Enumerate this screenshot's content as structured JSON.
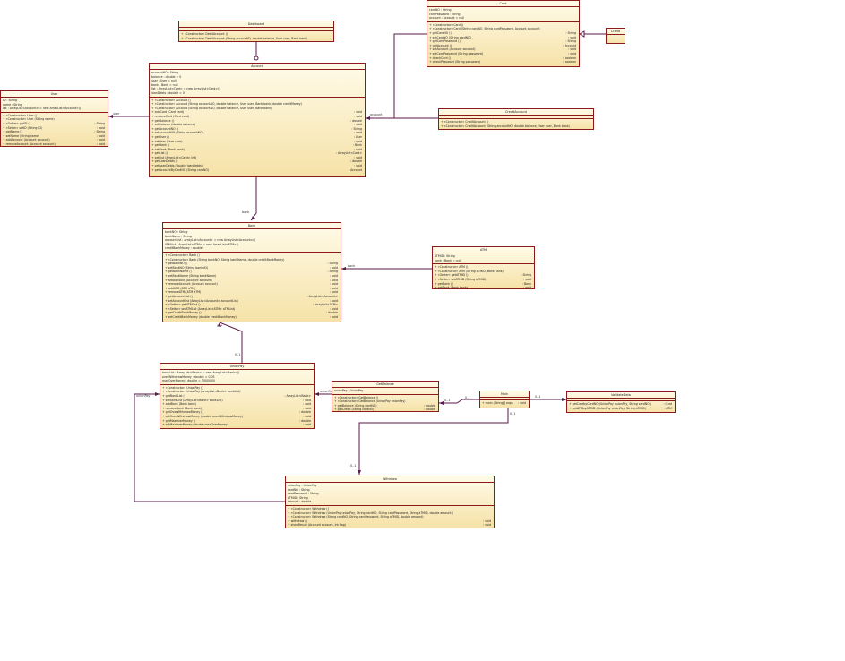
{
  "classes": {
    "dashboard": {
      "title": "Dashboard",
      "attrs": [],
      "methods": [
        "+ «Constructor» DebitAccount ()",
        "+ «Constructor» DebitAccount (String accountID, double balance, User user, Bank bank)"
      ]
    },
    "card": {
      "title": "Card",
      "attrs": [
        "cardNO : String",
        "cardPassword : String",
        "account : Account = null"
      ],
      "methods": [
        "+ «Constructor» Card ()",
        "+ «Constructor» Card (String cardNO, String cardPassword, Account account)",
        "+ getCardNO () : String",
        "+ setCardNO (String cardNO) : void",
        "+ getCardPassword () : String",
        "+ getAccount () : Account",
        "+ setAccount (Account account) : void",
        "+ setCardPassword (String password) : void",
        "+ checkCard () : boolean",
        "+ checkPassword (String password) : boolean"
      ]
    },
    "small": {
      "title": "Credit"
    },
    "user": {
      "title": "User",
      "attrs": [
        "ID : String",
        "name : String",
        "list : ArrayList<Account> = new ArrayList<Account>()"
      ],
      "methods": [
        "+ «Constructor» User ()",
        "+ «Constructor» User (String name)",
        "+ «Getter» getID () : String",
        "+ «Setter» setID (String ID) : void",
        "+ getName () : String",
        "+ setName (String name) : void",
        "+ addAccount (Account account) : void",
        "+ removeAccount (Account account) : void"
      ]
    },
    "account": {
      "title": "Account",
      "attrs": [
        "accountNO : String",
        "balance : double = 0",
        "user : User = null",
        "bank : Bank = null",
        "list : ArrayList<Card> = new ArrayList<Card>()",
        "loanDebts : double = 0"
      ],
      "methods": [
        "+ «Constructor» Account ()",
        "+ «Constructor» Account (String accountNO, double balance, User user, Bank bank, double creditMoney)",
        "+ «Constructor» Account (String accountNO, double balance, User user, Bank bank)",
        "+ addCard (Card card) : void",
        "+ removeCard (Card card) : void",
        "+ getBalance () : double",
        "+ setBalance (double balance) : void",
        "+ getAccountNO () : String",
        "+ setAccountNO (String accountNO) : void",
        "+ getUser () : User",
        "+ setUser (User user) : void",
        "+ getBank () : Bank",
        "+ setBank (Bank bank) : void",
        "+ getList () : ArrayList<Card>",
        "+ setList (ArrayList<Card> list) : void",
        "+ getLoanDebts () : double",
        "+ setLoanDebts (double loanDebts) : void",
        "+ getAccountByCardNO (String cardNO) : Account"
      ]
    },
    "creditAccount": {
      "title": "CreditAccount",
      "attrs": [],
      "methods": [
        "+ «Constructor» CreditAccount ()",
        "+ «Constructor» CreditAccount (String accountNO, double balance, User user, Bank bank)"
      ]
    },
    "bank": {
      "title": "Bank",
      "attrs": [
        "bankNO : String",
        "bankName : String",
        "accountList : ArrayList<Account> = new ArrayList<Account>()",
        "ATMList : ArrayList<ATM> = new ArrayList<ATM>()",
        "creditBankMoney : double"
      ],
      "methods": [
        "+ «Constructor» Bank ()",
        "+ «Constructor» Bank (String bankNO, String bankName, double creditBankMoney)",
        "+ getBankNO () : String",
        "+ setBankNO (String bankNO) : void",
        "+ getBankName () : String",
        "+ setBankName (String bankName) : void",
        "+ addAccount (Account account) : void",
        "+ removeAccount (Account account) : void",
        "+ addATM (ATM aTM) : void",
        "+ removeATM (ATM aTM) : void",
        "+ getAccountList () : ArrayList<Account>",
        "+ setAccountList (ArrayList<Account> accountList) : void",
        "+ «Getter» getATMList () : ArrayList<ATM>",
        "+ «Setter» setATMList (ArrayList<ATM> aTMList) : void",
        "+ getCreditBankMoney () : double",
        "+ setCreditBankMoney (double creditBankMoney) : void"
      ]
    },
    "atm": {
      "title": "ATM",
      "attrs": [
        "ATMID : String",
        "bank : Bank = null"
      ],
      "methods": [
        "+ «Constructor» ATM ()",
        "+ «Constructor» ATM (String aTMID, Bank bank)",
        "+ «Getter» getATMID () : String",
        "+ «Setter» setATMID (String aTMID) : void",
        "+ getBank () : Bank",
        "+ setBank (Bank bank) : void"
      ]
    },
    "unionPay": {
      "title": "UnionPay",
      "attrs": [
        "bankList : ArrayList<Bank> = new ArrayList<Bank>()",
        "overWithdrawMoney : double = 0.05",
        "maxOverMoney : double = 50000.00"
      ],
      "methods": [
        "+ «Constructor» UnionPay ()",
        "+ «Constructor» UnionPay (ArrayList<Bank> bankList)",
        "+ getBankList () : ArrayList<Bank>",
        "+ setBankList (ArrayList<Bank> bankList) : void",
        "+ addBank (Bank bank) : void",
        "+ removeBank (Bank bank) : void",
        "+ getOverWithdrawMoney () : double",
        "+ setOverWithdrawMoney (double overWithdrawMoney) : void",
        "+ getMaxOverMoney () : double",
        "+ setMaxOverMoney (double maxOverMoney) : void"
      ]
    },
    "getBalance": {
      "title": "GetBalance",
      "attrs": [
        "unionPay : UnionPay"
      ],
      "methods": [
        "+ «Constructor» GetBalance ()",
        "+ «Constructor» GetBalance (UnionPay unionPay)",
        "+ getBalance (String cardNO) : double",
        "+ getCredit (String cardNO) : double"
      ]
    },
    "main": {
      "title": "Main",
      "attrs": [],
      "methods": [
        "+ main (String[] args) : void"
      ]
    },
    "validateData": {
      "title": "ValidateData",
      "attrs": [],
      "methods": [
        "+ getCardbyCardNO (UnionPay unionPay, String cardNO) : Card",
        "+ getATMbyATMID (UnionPay unionPay, String aTMID) : ATM"
      ]
    },
    "withdraw": {
      "title": "Withdraw",
      "attrs": [
        "unionPay : UnionPay",
        "cardNO : String",
        "cardPassword : String",
        "ATMID : String",
        "amount : double"
      ],
      "methods": [
        "+ «Constructor» Withdraw ()",
        "+ «Constructor» Withdraw (UnionPay unionPay, String cardNO, String cardPassword, String aTMID, double amount)",
        "+ «Constructor» Withdraw (String cardNO, String cardPassword, String aTMID, double amount)",
        "+ withdraw () : void",
        "+ showResult (Account account, int flag) : void"
      ]
    }
  },
  "edge_labels": {
    "user": "user",
    "account": "account",
    "bank": "bank",
    "bank2": "bank",
    "unionPay": "unionPay",
    "unionPay2": "unionPay",
    "m01a": "0..1",
    "m01b": "0..1",
    "m01c": "0..1",
    "m01d": "0..1",
    "m01e": "0..1",
    "m01f": "0..1",
    "mStar": "0..*"
  }
}
